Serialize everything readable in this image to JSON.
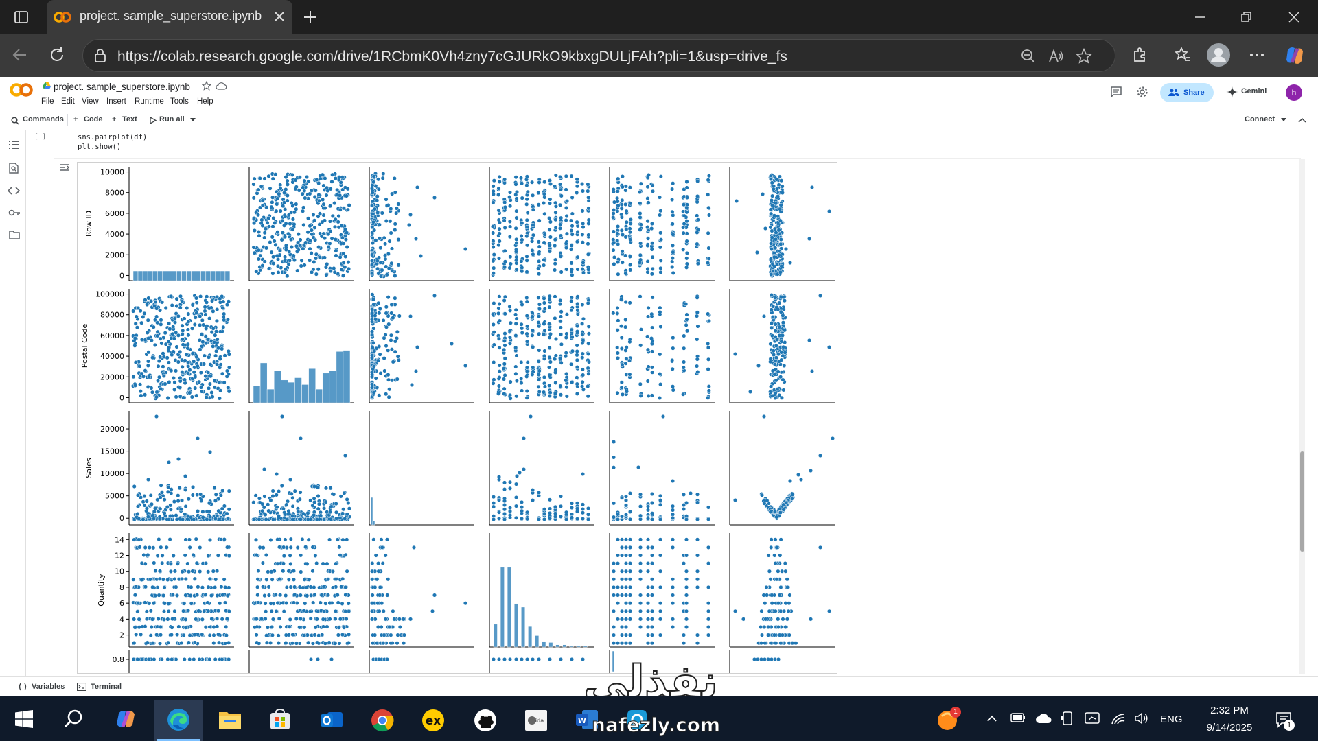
{
  "browser": {
    "tab_title": "project. sample_superstore.ipynb",
    "url": "https://colab.research.google.com/drive/1RCbmK0Vh4zny7cGJURkO9kbxgDULjFAh?pli=1&usp=drive_fs"
  },
  "colab": {
    "logo": "CO",
    "notebook_name": "project. sample_superstore.ipynb",
    "menu": [
      "File",
      "Edit",
      "View",
      "Insert",
      "Runtime",
      "Tools",
      "Help"
    ],
    "share_label": "Share",
    "gemini_label": "Gemini",
    "avatar_letter": "h"
  },
  "toolbar": {
    "commands": "Commands",
    "code": "Code",
    "text": "Text",
    "run_all": "Run all",
    "connect": "Connect"
  },
  "cell": {
    "bracket": "[ ]",
    "code_lines": [
      "sns.pairplot(df)",
      "plt.show()"
    ]
  },
  "chart_data": {
    "type": "scatter",
    "subtype": "pairplot",
    "variables": [
      "Row ID",
      "Postal Code",
      "Sales",
      "Quantity"
    ],
    "diagonal": "histogram",
    "color": "#1f77b4",
    "y_ticks": {
      "Row ID": [
        0,
        2000,
        4000,
        6000,
        8000,
        10000
      ],
      "Postal Code": [
        0,
        20000,
        40000,
        60000,
        80000,
        100000
      ],
      "Sales": [
        0,
        5000,
        10000,
        15000,
        20000
      ],
      "Quantity": [
        2,
        4,
        6,
        8,
        10,
        12,
        14
      ]
    },
    "extra_row_tick": "0.8"
  },
  "bottom": {
    "variables": "Variables",
    "terminal": "Terminal"
  },
  "taskbar": {
    "language": "ENG",
    "time": "2:32 PM",
    "date": "9/14/2025",
    "notification_count": "1",
    "app_badge": "1"
  },
  "watermark": {
    "arabic": "نفذلي",
    "latin": "nafezly.com"
  }
}
